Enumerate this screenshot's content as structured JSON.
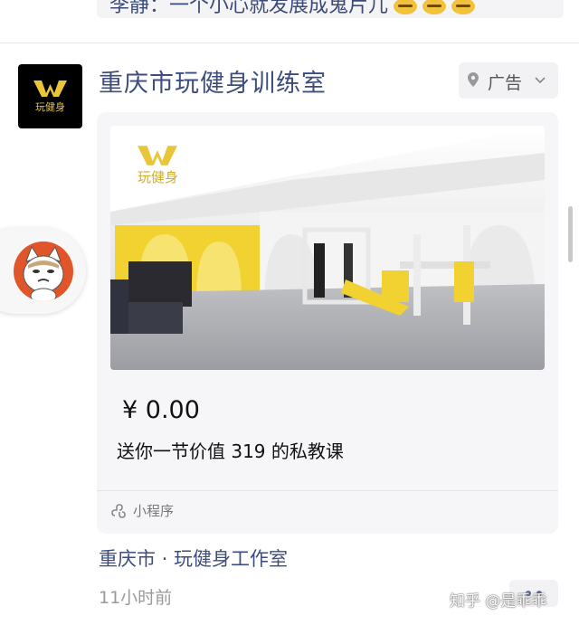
{
  "comment": {
    "text": "李静：一个小心就发展成鬼片儿"
  },
  "ad": {
    "advertiser_name": "重庆市玩健身训练室",
    "avatar_text": "玩健身",
    "badge_label": "广告",
    "price": "¥ 0.00",
    "offer_text": "送你一节价值 319 的私教课",
    "mini_program_label": "小程序",
    "photo_logo_text": "玩健身",
    "location": "重庆市 · 玩健身工作室",
    "time": "11小时前"
  },
  "watermark": "知乎 @是乖乖",
  "colors": {
    "link_blue": "#3d4d7e",
    "brand_yellow": "#f2d230",
    "card_bg": "#f6f6f8"
  }
}
